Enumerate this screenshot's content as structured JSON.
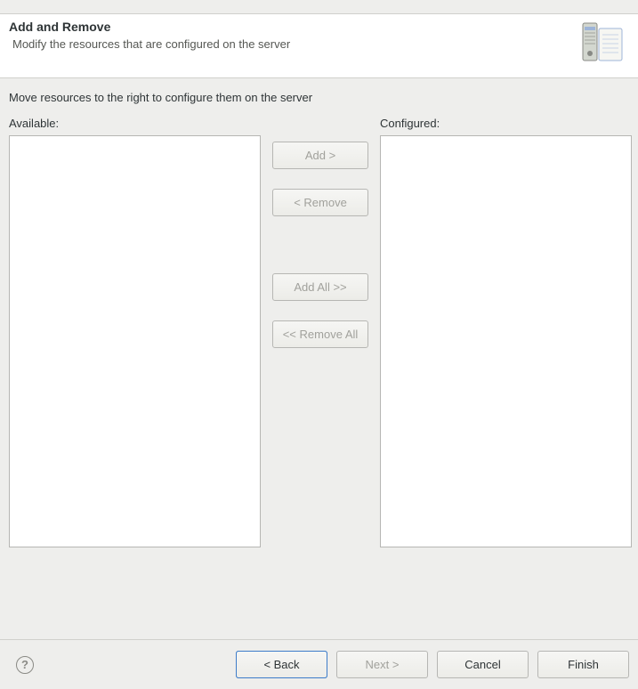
{
  "header": {
    "title": "Add and Remove",
    "subtitle": "Modify the resources that are configured on the server"
  },
  "content": {
    "instruction": "Move resources to the right to configure them on the server",
    "available_label": "Available:",
    "configured_label": "Configured:",
    "available_items": [],
    "configured_items": []
  },
  "buttons": {
    "add": "Add >",
    "remove": "< Remove",
    "add_all": "Add All >>",
    "remove_all": "<< Remove All",
    "back": "< Back",
    "next": "Next >",
    "cancel": "Cancel",
    "finish": "Finish"
  },
  "icons": {
    "help": "?"
  }
}
